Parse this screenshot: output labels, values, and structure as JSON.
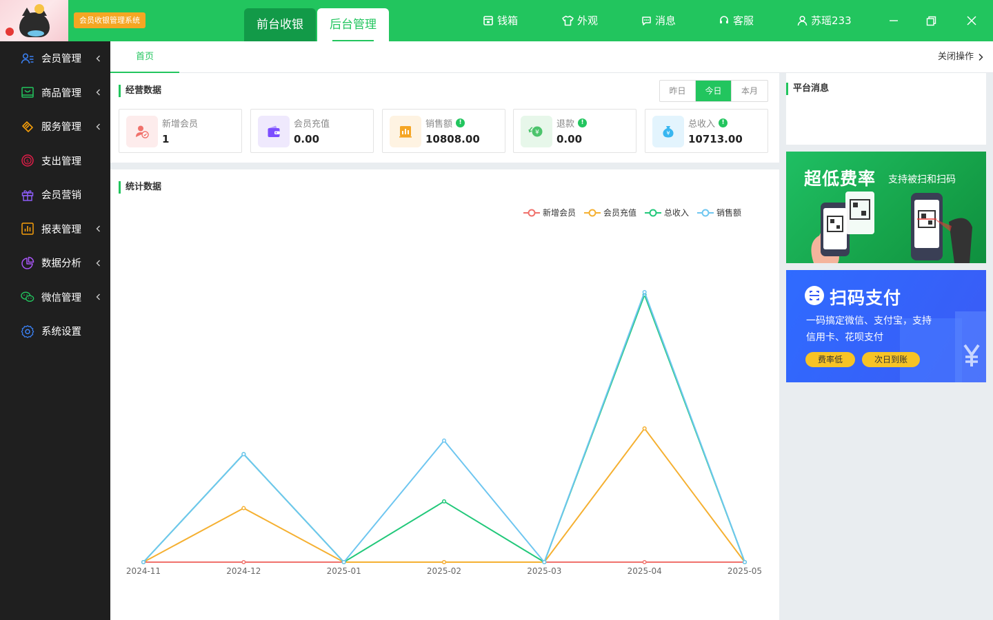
{
  "header": {
    "system_badge": "会员收银管理系统",
    "mode_tabs": [
      "前台收银",
      "后台管理"
    ],
    "nav": [
      {
        "label": "钱箱",
        "icon": "cashbox-icon"
      },
      {
        "label": "外观",
        "icon": "tshirt-icon"
      },
      {
        "label": "消息",
        "icon": "message-icon"
      },
      {
        "label": "客服",
        "icon": "headset-icon"
      },
      {
        "label": "苏瑶233",
        "icon": "user-icon"
      }
    ],
    "window_controls": [
      "minimize-icon",
      "restore-icon",
      "close-icon"
    ]
  },
  "sidebar": {
    "items": [
      {
        "label": "会员管理",
        "icon": "member-icon",
        "icon_color": "#3b82f6",
        "expandable": true
      },
      {
        "label": "商品管理",
        "icon": "goods-icon",
        "icon_color": "#22c55e",
        "expandable": true
      },
      {
        "label": "服务管理",
        "icon": "service-icon",
        "icon_color": "#f59e0b",
        "expandable": true
      },
      {
        "label": "支出管理",
        "icon": "expense-icon",
        "icon_color": "#e11d48",
        "expandable": false
      },
      {
        "label": "会员营销",
        "icon": "gift-icon",
        "icon_color": "#8b5cf6",
        "expandable": false
      },
      {
        "label": "报表管理",
        "icon": "report-icon",
        "icon_color": "#f59e0b",
        "expandable": true
      },
      {
        "label": "数据分析",
        "icon": "pie-chart-icon",
        "icon_color": "#a855f7",
        "expandable": true
      },
      {
        "label": "微信管理",
        "icon": "wechat-icon",
        "icon_color": "#22c55e",
        "expandable": true
      },
      {
        "label": "系统设置",
        "icon": "gear-icon",
        "icon_color": "#3b82f6",
        "expandable": false
      }
    ]
  },
  "tabs": {
    "home": "首页",
    "close_ops": "关闭操作"
  },
  "business": {
    "title": "经营数据",
    "periods": [
      "昨日",
      "今日",
      "本月"
    ],
    "active_period": "今日",
    "cards": [
      {
        "label": "新增会员",
        "value": "1",
        "icon": "new-member-icon",
        "bg": "#fdecec",
        "color": "#f0716b",
        "info": false
      },
      {
        "label": "会员充值",
        "value": "0.00",
        "icon": "wallet-icon",
        "bg": "#efe9fd",
        "color": "#7c4dff",
        "info": false
      },
      {
        "label": "销售额",
        "value": "10808.00",
        "icon": "sales-icon",
        "bg": "#fef3e2",
        "color": "#f5a524",
        "info": true
      },
      {
        "label": "退款",
        "value": "0.00",
        "icon": "refund-icon",
        "bg": "#e7f7ea",
        "color": "#4cc46c",
        "info": true
      },
      {
        "label": "总收入",
        "value": "10713.00",
        "icon": "income-icon",
        "bg": "#e3f4fd",
        "color": "#38b6f0",
        "info": true
      }
    ]
  },
  "stats": {
    "title": "统计数据"
  },
  "chart_data": {
    "type": "line",
    "categories": [
      "2024-11",
      "2024-12",
      "2025-01",
      "2025-02",
      "2025-03",
      "2025-04",
      "2025-05"
    ],
    "ylim": [
      0,
      100
    ],
    "grid": false,
    "legend_position": "top-right",
    "series": [
      {
        "name": "新增会员",
        "color": "#f0716b",
        "values": [
          0,
          0,
          0,
          0,
          0,
          0,
          0
        ]
      },
      {
        "name": "会员充值",
        "color": "#f5b031",
        "values": [
          0,
          20,
          0,
          0,
          0,
          49.5,
          0
        ]
      },
      {
        "name": "总收入",
        "color": "#22c87a",
        "values": [
          0,
          40,
          0,
          22.5,
          0,
          99,
          0
        ]
      },
      {
        "name": "销售额",
        "color": "#6ec6f0",
        "values": [
          0,
          40,
          0,
          45,
          0,
          100,
          0
        ]
      }
    ]
  },
  "right": {
    "platform_title": "平台消息",
    "promo1": {
      "title": "超低费率",
      "subtitle": "支持被扫和扫码"
    },
    "promo2": {
      "title": "扫码支付",
      "line1": "一码搞定微信、支付宝，支持",
      "line2": "信用卡、花呗支付",
      "pills": [
        "费率低",
        "次日到账"
      ]
    }
  }
}
